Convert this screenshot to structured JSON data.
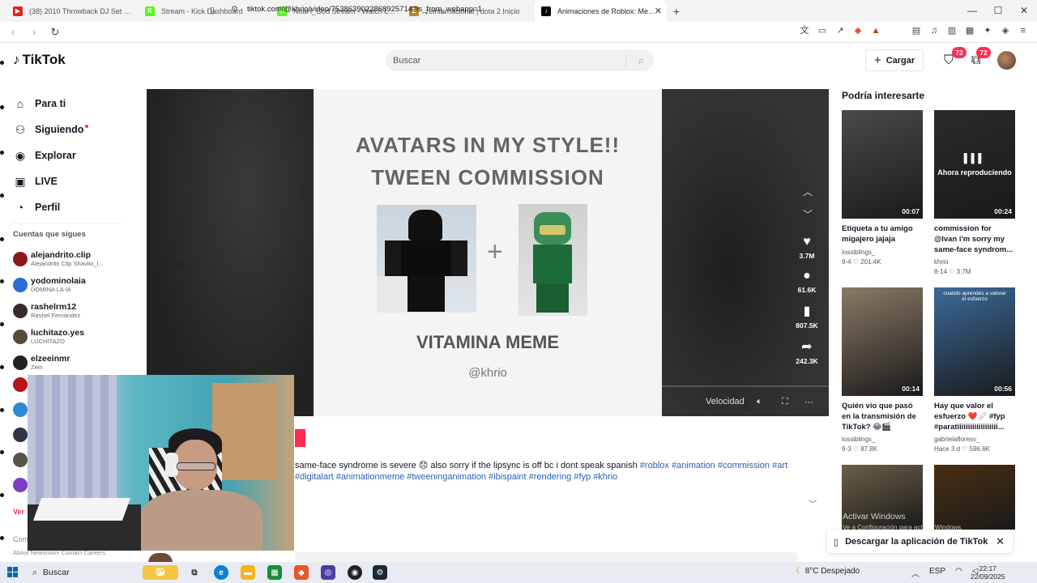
{
  "browser": {
    "tabs": [
      {
        "label": "(38) 2010 Throwback DJ Set (Rihanna",
        "color": "#e62117",
        "glyph": "▶"
      },
      {
        "label": "Stream - Kick Dashboard",
        "color": "#53fc18",
        "glyph": "K"
      },
      {
        "label": "NoaH_God Stream - Watch Live on K",
        "color": "#53fc18",
        "glyph": "K"
      },
      {
        "label": "zeinternacional | dota 2 Inicio",
        "color": "#b48a21",
        "glyph": "Z"
      },
      {
        "label": "Animaciones de Roblox: Memes",
        "color": "#000000",
        "glyph": "♪"
      }
    ],
    "url": "tiktok.com/@khrio/video/7538639022868925714?is_from_webapp=1"
  },
  "header": {
    "logo_text": "TikTok",
    "search_placeholder": "Buscar",
    "upload_label": "Cargar",
    "inbox_badge": "72",
    "messages_badge": "72"
  },
  "nav": {
    "items": [
      {
        "label": "Para ti",
        "icon": "home-icon",
        "glyph": "⌂"
      },
      {
        "label": "Siguiendo",
        "icon": "following-icon",
        "glyph": "⚇"
      },
      {
        "label": "Explorar",
        "icon": "compass-icon",
        "glyph": "◉"
      },
      {
        "label": "LIVE",
        "icon": "live-icon",
        "glyph": "▣"
      },
      {
        "label": "Perfil",
        "icon": "profile-icon",
        "glyph": "◔"
      }
    ],
    "following_title": "Cuentas que sigues",
    "following": [
      {
        "name": "alejandrito.clip",
        "sub": "Alejandrito Clip Shavito_l...",
        "color": "#8b1a1a"
      },
      {
        "name": "yodominolaia",
        "sub": "DOMINA LA IA",
        "color": "#2b6cd4"
      },
      {
        "name": "rashelrm12",
        "sub": "Rashel Fernández",
        "color": "#3a2a2a"
      },
      {
        "name": "luchitazo.yes",
        "sub": "LUCHITAZO",
        "color": "#5a4a3a"
      },
      {
        "name": "elzeeinmr",
        "sub": "Zein",
        "color": "#222222"
      }
    ],
    "more_label": "Ver",
    "footer_co": "Com",
    "footer_links": "About   Newsroom   Contact   Careers"
  },
  "video": {
    "title_line1": "AVATARS IN MY STYLE!!",
    "title_line2": "TWEEN COMMISSION",
    "subtitle": "VITAMINA MEME",
    "handle": "@khrio",
    "likes": "3.7M",
    "comments": "61.6K",
    "saves": "807.5K",
    "shares": "242.3K",
    "speed_label": "Velocidad"
  },
  "caption": {
    "text": "same-face syndrome is severe 😞 also sorry if the lipsync is off bc i dont speak spanish",
    "tags": [
      "#roblox",
      "#animation",
      "#commission",
      "#art",
      "#digitalart",
      "#animationmeme",
      "#tweeninganimation",
      "#ibispaint",
      "#rendering",
      "#fyp",
      "#khrio"
    ]
  },
  "right": {
    "title": "Podría interesarte",
    "cards": [
      {
        "title": "Etiqueta a tu amigo migajero jajaja",
        "author": "lossiblings_",
        "date": "9-4",
        "likes": "201.4K",
        "duration": "00:07",
        "bg": "#4a4a4a"
      },
      {
        "title": "commission for @lvan i'm sorry my same-face syndrom...",
        "author": "khrio",
        "date": "8-14",
        "likes": "3.7M",
        "duration": "00:24",
        "bg": "#2a2a2a",
        "now_playing": "Ahora reproduciendo"
      },
      {
        "title": "Quién vio que pasó en la transmisión de TikTok? 😂🎬",
        "author": "lossiblings_",
        "date": "9-3",
        "likes": "87.8K",
        "duration": "00:14",
        "bg": "#8a7a66"
      },
      {
        "title": "Hay que valor el esfuerzo ❤️🩹 #fyp #paratiiiiiiiiiiiiiiiiiii...",
        "author": "gabrielafloresv_",
        "date": "Hace 3 d",
        "likes": "596.6K",
        "duration": "00:56",
        "bg": "#3b6a9a",
        "overlay": "cuando aprendes a valorar el esfuerzo"
      },
      {
        "bg": "#6b6048"
      },
      {
        "bg": "#4a2e12"
      }
    ],
    "download_banner": "Descargar la aplicación de TikTok",
    "activate_line1": "Activar Windows",
    "activate_line2": "Ve a Configuración para activar Windows."
  },
  "taskbar": {
    "search_label": "Buscar",
    "weather": "8°C  Despejado",
    "lang": "ESP",
    "time": "22:17",
    "date": "22/09/2025"
  }
}
